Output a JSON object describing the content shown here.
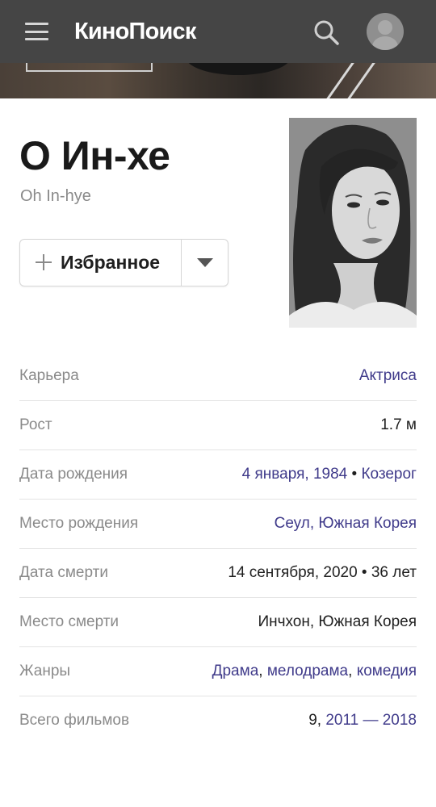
{
  "header": {
    "logo": "КиноПоиск",
    "icons": {
      "menu": "hamburger-menu-icon",
      "search": "search-icon",
      "avatar": "user-avatar-icon"
    }
  },
  "person": {
    "name": "О Ин-хе",
    "original_name": "Oh In-hye",
    "favorite_label": "Избранное",
    "favorite_icon": "plus-icon",
    "dropdown_icon": "caret-down-icon"
  },
  "info": {
    "career": {
      "label": "Карьера",
      "value": "Актриса"
    },
    "height": {
      "label": "Рост",
      "value": "1.7 м"
    },
    "birth_date": {
      "label": "Дата рождения",
      "date": "4 января, 1984",
      "sep": " • ",
      "sign": "Козерог"
    },
    "birth_place": {
      "label": "Место рождения",
      "value": "Сеул, Южная Корея"
    },
    "death_date": {
      "label": "Дата смерти",
      "value": "14 сентября, 2020 • 36 лет"
    },
    "death_place": {
      "label": "Место смерти",
      "value": "Инчхон, Южная Корея"
    },
    "genres": {
      "label": "Жанры",
      "g1": "Драма",
      "comma1": ", ",
      "g2": "мелодрама",
      "comma2": ", ",
      "g3": "комедия"
    },
    "total_films": {
      "label": "Всего фильмов",
      "count": "9, ",
      "range": "2011 — 2018"
    }
  },
  "colors": {
    "header_bg": "#454545",
    "link": "#3f3a8a",
    "label": "#8a8a8a",
    "text": "#1f1f1f"
  }
}
